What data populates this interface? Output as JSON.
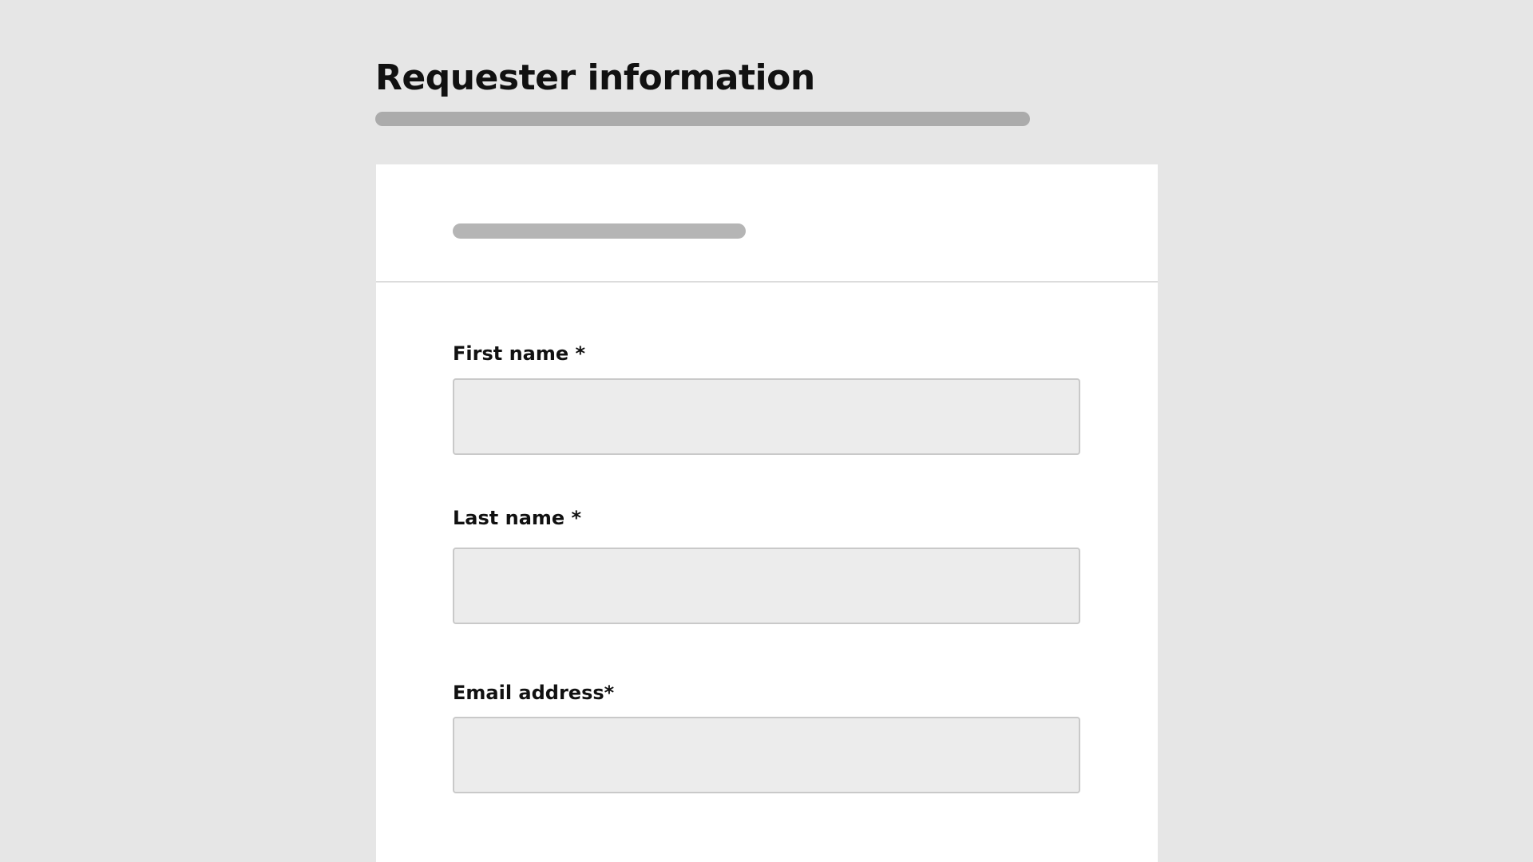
{
  "page": {
    "title": "Requester information"
  },
  "form": {
    "fields": [
      {
        "label": "First name *",
        "value": ""
      },
      {
        "label": "Last name *",
        "value": ""
      },
      {
        "label": "Email address*",
        "value": ""
      }
    ]
  },
  "colors": {
    "background": "#e6e6e6",
    "card": "#ffffff",
    "input_fill": "#ececec",
    "placeholder_bar": "#ababab",
    "text": "#111111"
  }
}
